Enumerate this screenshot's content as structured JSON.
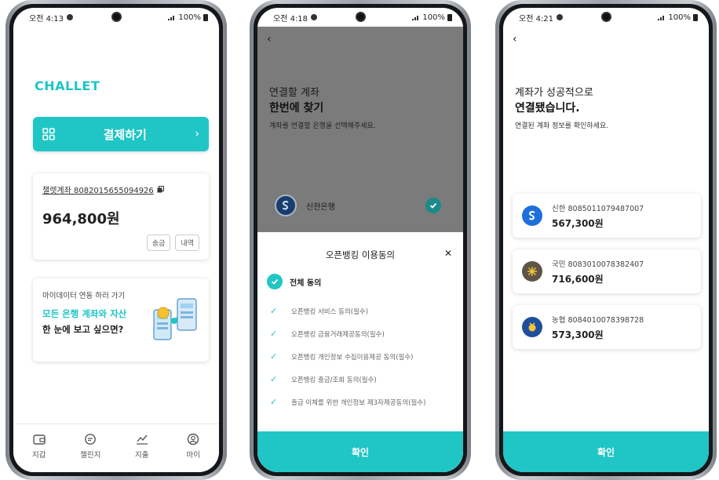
{
  "status": [
    {
      "time": "오전 4:13",
      "battery": "100%"
    },
    {
      "time": "오전 4:18",
      "battery": "100%"
    },
    {
      "time": "오전 4:21",
      "battery": "100%"
    }
  ],
  "wallet": {
    "logo": "CHALLET",
    "pay_button": "결제하기",
    "account_label": "챌렛계좌 8082015655094926",
    "balance": "964,800원",
    "send_button": "송금",
    "history_button": "내역",
    "promo": {
      "subtitle": "마이데이터 연동 하러 가기",
      "highlight": "모든 은행 계좌와 자산",
      "text": "한 눈에 보고 싶으면?"
    },
    "nav": [
      {
        "label": "지갑",
        "icon": "wallet-icon"
      },
      {
        "label": "챌린지",
        "icon": "chat-icon"
      },
      {
        "label": "지출",
        "icon": "chart-icon"
      },
      {
        "label": "마이",
        "icon": "user-icon"
      }
    ]
  },
  "find": {
    "title_line1": "연결할 계좌",
    "title_line2": "한번에 찾기",
    "description": "계좌를 연결할 은행을 선택해주세요.",
    "bank": "신한은행",
    "sheet": {
      "title": "오픈뱅킹 이용동의",
      "all_agree": "전체 동의",
      "terms": [
        "오픈뱅킹 서비스 동의(필수)",
        "오픈뱅킹 금융거래제공동의(필수)",
        "오픈뱅킹 개인정보 수집이용제공 동의(필수)",
        "오픈뱅킹 출금/조회 동의(필수)",
        "출금 이체를 위한 개인정보 제3자제공동의(필수)"
      ],
      "confirm": "확인"
    }
  },
  "success": {
    "title_line1": "계좌가 성공적으로",
    "title_line2": "연결됐습니다.",
    "description": "연결된 계좌 정보를 확인하세요.",
    "accounts": [
      {
        "name": "신한 8085011079487007",
        "balance": "567,300원",
        "color": "#1e6fd9"
      },
      {
        "name": "국민 8083010078382407",
        "balance": "716,600원",
        "color": "#5e5546"
      },
      {
        "name": "농협 8084010078398728",
        "balance": "573,300원",
        "color": "#1f4f9c"
      }
    ],
    "confirm": "확인"
  },
  "colors": {
    "accent": "#20c6c5"
  }
}
